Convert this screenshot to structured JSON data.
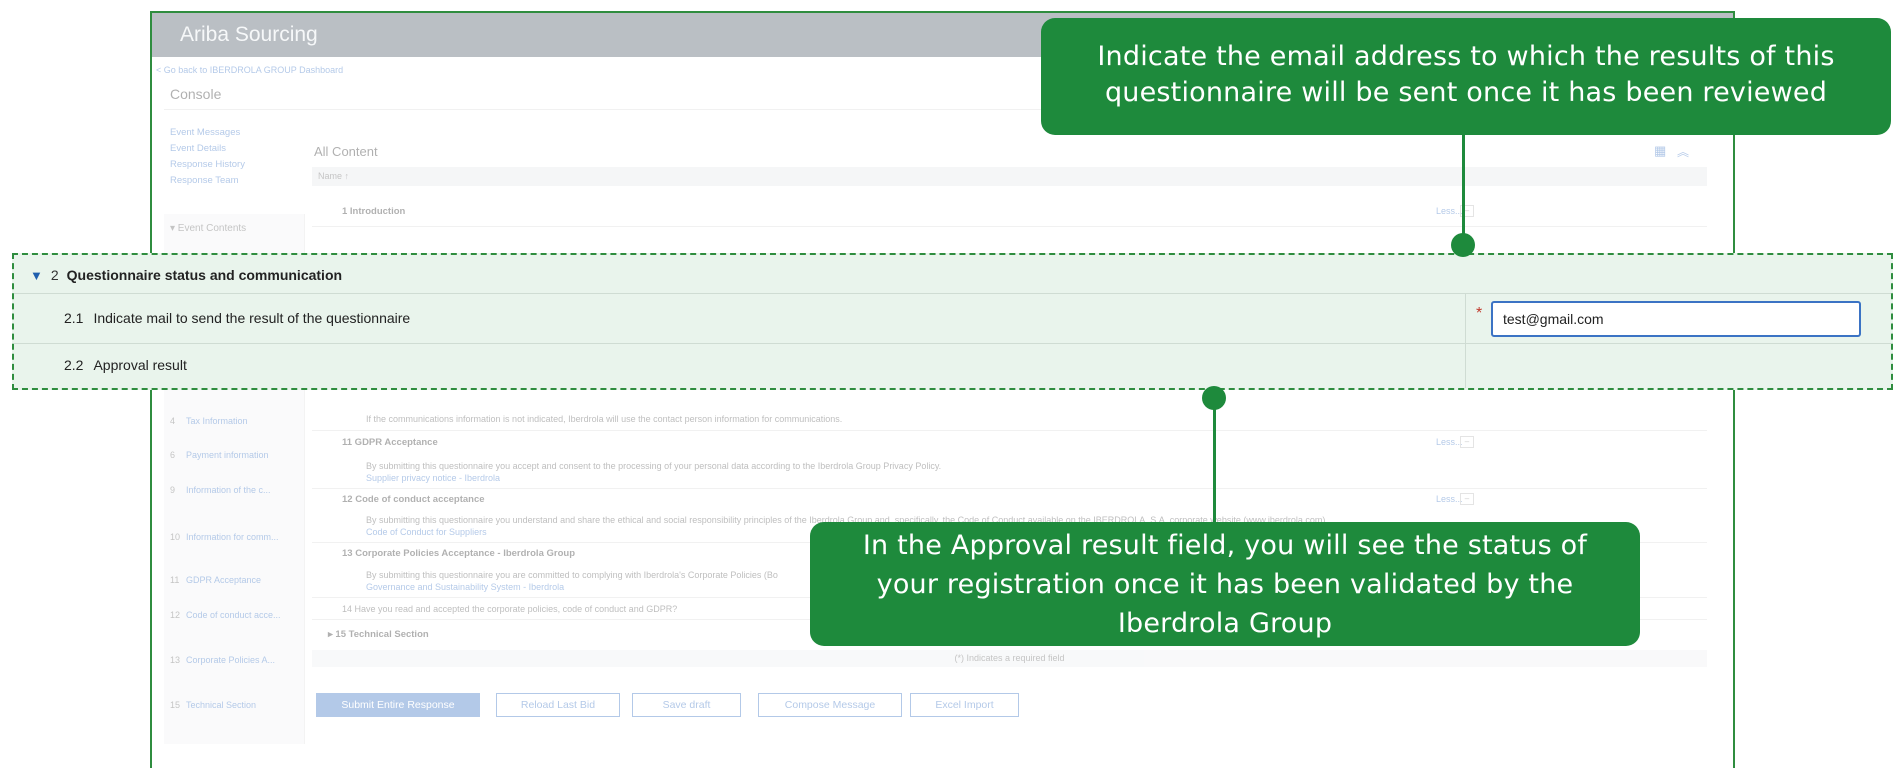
{
  "app": {
    "title": "Ariba Sourcing",
    "back_link": "< Go back to IBERDROLA GROUP Dashboard",
    "console_title": "Console"
  },
  "sidebar": {
    "links": [
      "Event Messages",
      "Event Details",
      "Response History",
      "Response Team"
    ],
    "event_contents_label": "▾ Event Contents",
    "items": [
      {
        "num": "4",
        "label": "Tax Information"
      },
      {
        "num": "6",
        "label": "Payment information"
      },
      {
        "num": "9",
        "label": "Information of the c..."
      },
      {
        "num": "10",
        "label": "Information for comm..."
      },
      {
        "num": "11",
        "label": "GDPR Acceptance"
      },
      {
        "num": "12",
        "label": "Code of conduct acce..."
      },
      {
        "num": "13",
        "label": "Corporate Policies A..."
      },
      {
        "num": "15",
        "label": "Technical Section"
      }
    ]
  },
  "content": {
    "heading": "All Content",
    "name_header": "Name ↑",
    "intro_row": "1  Introduction",
    "less_label": "Less...",
    "comm_note": "If the communications information is not indicated, Iberdrola will use the contact person information for communications.",
    "gdpr_title": "11  GDPR Acceptance",
    "gdpr_text": "By submitting this questionnaire you accept and consent to the processing of your personal data according to the Iberdrola Group Privacy Policy.",
    "gdpr_link": "Supplier privacy notice - Iberdrola",
    "conduct_title": "12  Code of conduct acceptance",
    "conduct_text": "By submitting this questionnaire you understand and share the ethical and social responsibility principles of the Iberdrola Group and, specifically, the Code of Conduct available on the IBERDROLA, S.A. corporate website (www.iberdrola.com).",
    "conduct_link": "Code of Conduct for Suppliers",
    "policies_title": "13  Corporate Policies Acceptance - Iberdrola Group",
    "policies_text": "By submitting this questionnaire you are committed to complying with Iberdrola's Corporate Policies (Bo",
    "policies_link": "Governance and Sustainability System - Iberdrola",
    "q14": "14  Have you read and accepted the corporate policies, code of conduct and GDPR?",
    "technical_section": "▸ 15  Technical Section",
    "required_note": "(*) Indicates a required field"
  },
  "highlight": {
    "section_arrow": "▼",
    "section_num": "2",
    "section_title": "Questionnaire status and communication",
    "q1_num": "2.1",
    "q1_label": "Indicate mail to send the result of the questionnaire",
    "q2_num": "2.2",
    "q2_label": "Approval result",
    "required_marker": "*",
    "email_value": "test@gmail.com"
  },
  "buttons": {
    "submit": "Submit Entire Response",
    "reload": "Reload Last Bid",
    "save": "Save draft",
    "compose": "Compose Message",
    "excel": "Excel Import"
  },
  "icons": {
    "grid": "grid-icon",
    "collapse": "collapse-up-icon"
  },
  "colors": {
    "callout_green": "#1e8a3c",
    "highlight_bg": "#e9f4ec",
    "link_blue": "#3b73c4"
  },
  "callouts": {
    "email": {
      "line1": "Indicate the email address to which the results of this",
      "line2": "questionnaire will be sent once it has been reviewed"
    },
    "approval": {
      "line1": "In the Approval result field, you will see the status of",
      "line2": "your registration once it has been validated by the",
      "line3": "Iberdrola Group"
    }
  }
}
